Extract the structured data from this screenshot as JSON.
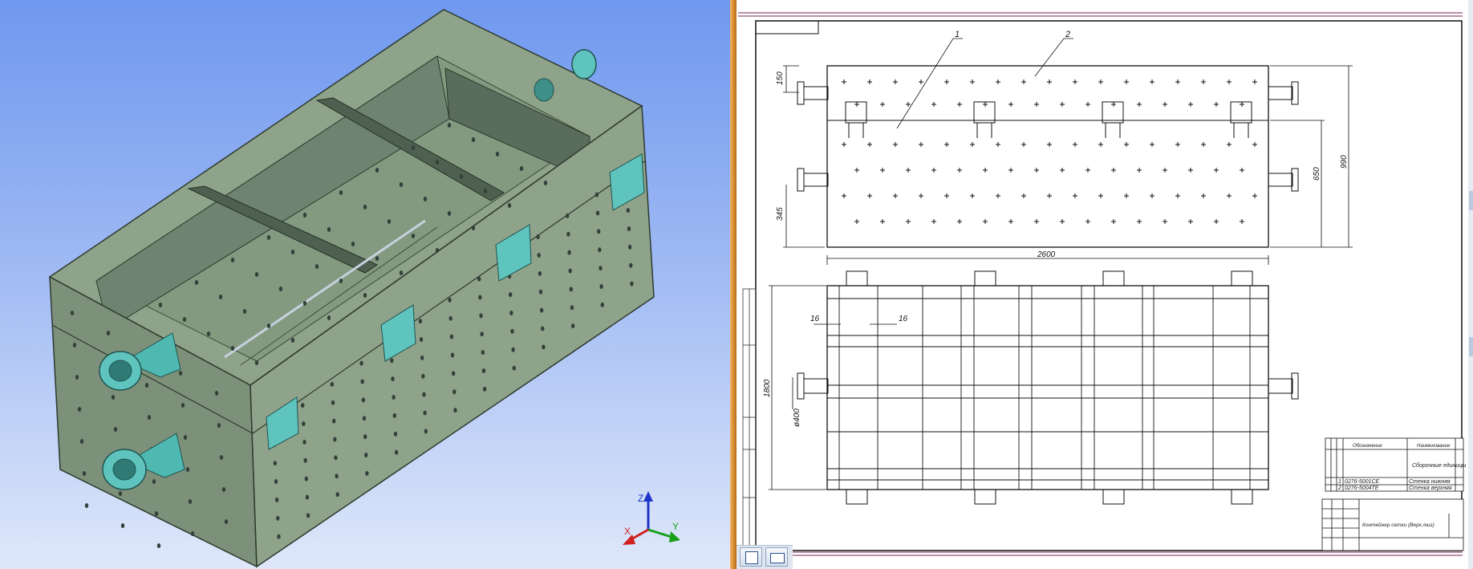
{
  "colors": {
    "viewport_top": "#6f98ef",
    "viewport_bottom": "#dfe8fa",
    "model_face_light": "#93a58c",
    "model_face_mid": "#7f937b",
    "model_face_dark": "#5e705f",
    "fitting": "#5fc4bd",
    "splitter": "#d9902f",
    "axis_x": "#d02020",
    "axis_y": "#19a019",
    "axis_z": "#1d35c8"
  },
  "viewport": {
    "axis_labels": {
      "x": "X",
      "y": "Y",
      "z": "Z"
    },
    "icons": [
      "axis-triad-icon"
    ]
  },
  "drawing": {
    "leaders": [
      "1",
      "2"
    ],
    "dimensions": {
      "top_left_upper": "150",
      "top_left_lower": "345",
      "right_inner": "650",
      "right_outer": "990",
      "length": "2600",
      "front_height": "1800",
      "spacing_a": "16",
      "spacing_b": "16",
      "diameter": "ø400"
    },
    "spec_rows": [
      {
        "n": "1",
        "code": "0276-5001СЕ",
        "name": "Стенка нижняя"
      },
      {
        "n": "2",
        "code": "0276-5004ТЕ",
        "name": "Стенка верхняя"
      }
    ],
    "spec_header": {
      "a": "Обозначение",
      "b": "Наименование",
      "c": "Сборочные единицы"
    },
    "stamp_title": "Контейнер сетки (Верх./низ)",
    "view_buttons": [
      "portrait-page-icon",
      "landscape-page-icon"
    ]
  }
}
